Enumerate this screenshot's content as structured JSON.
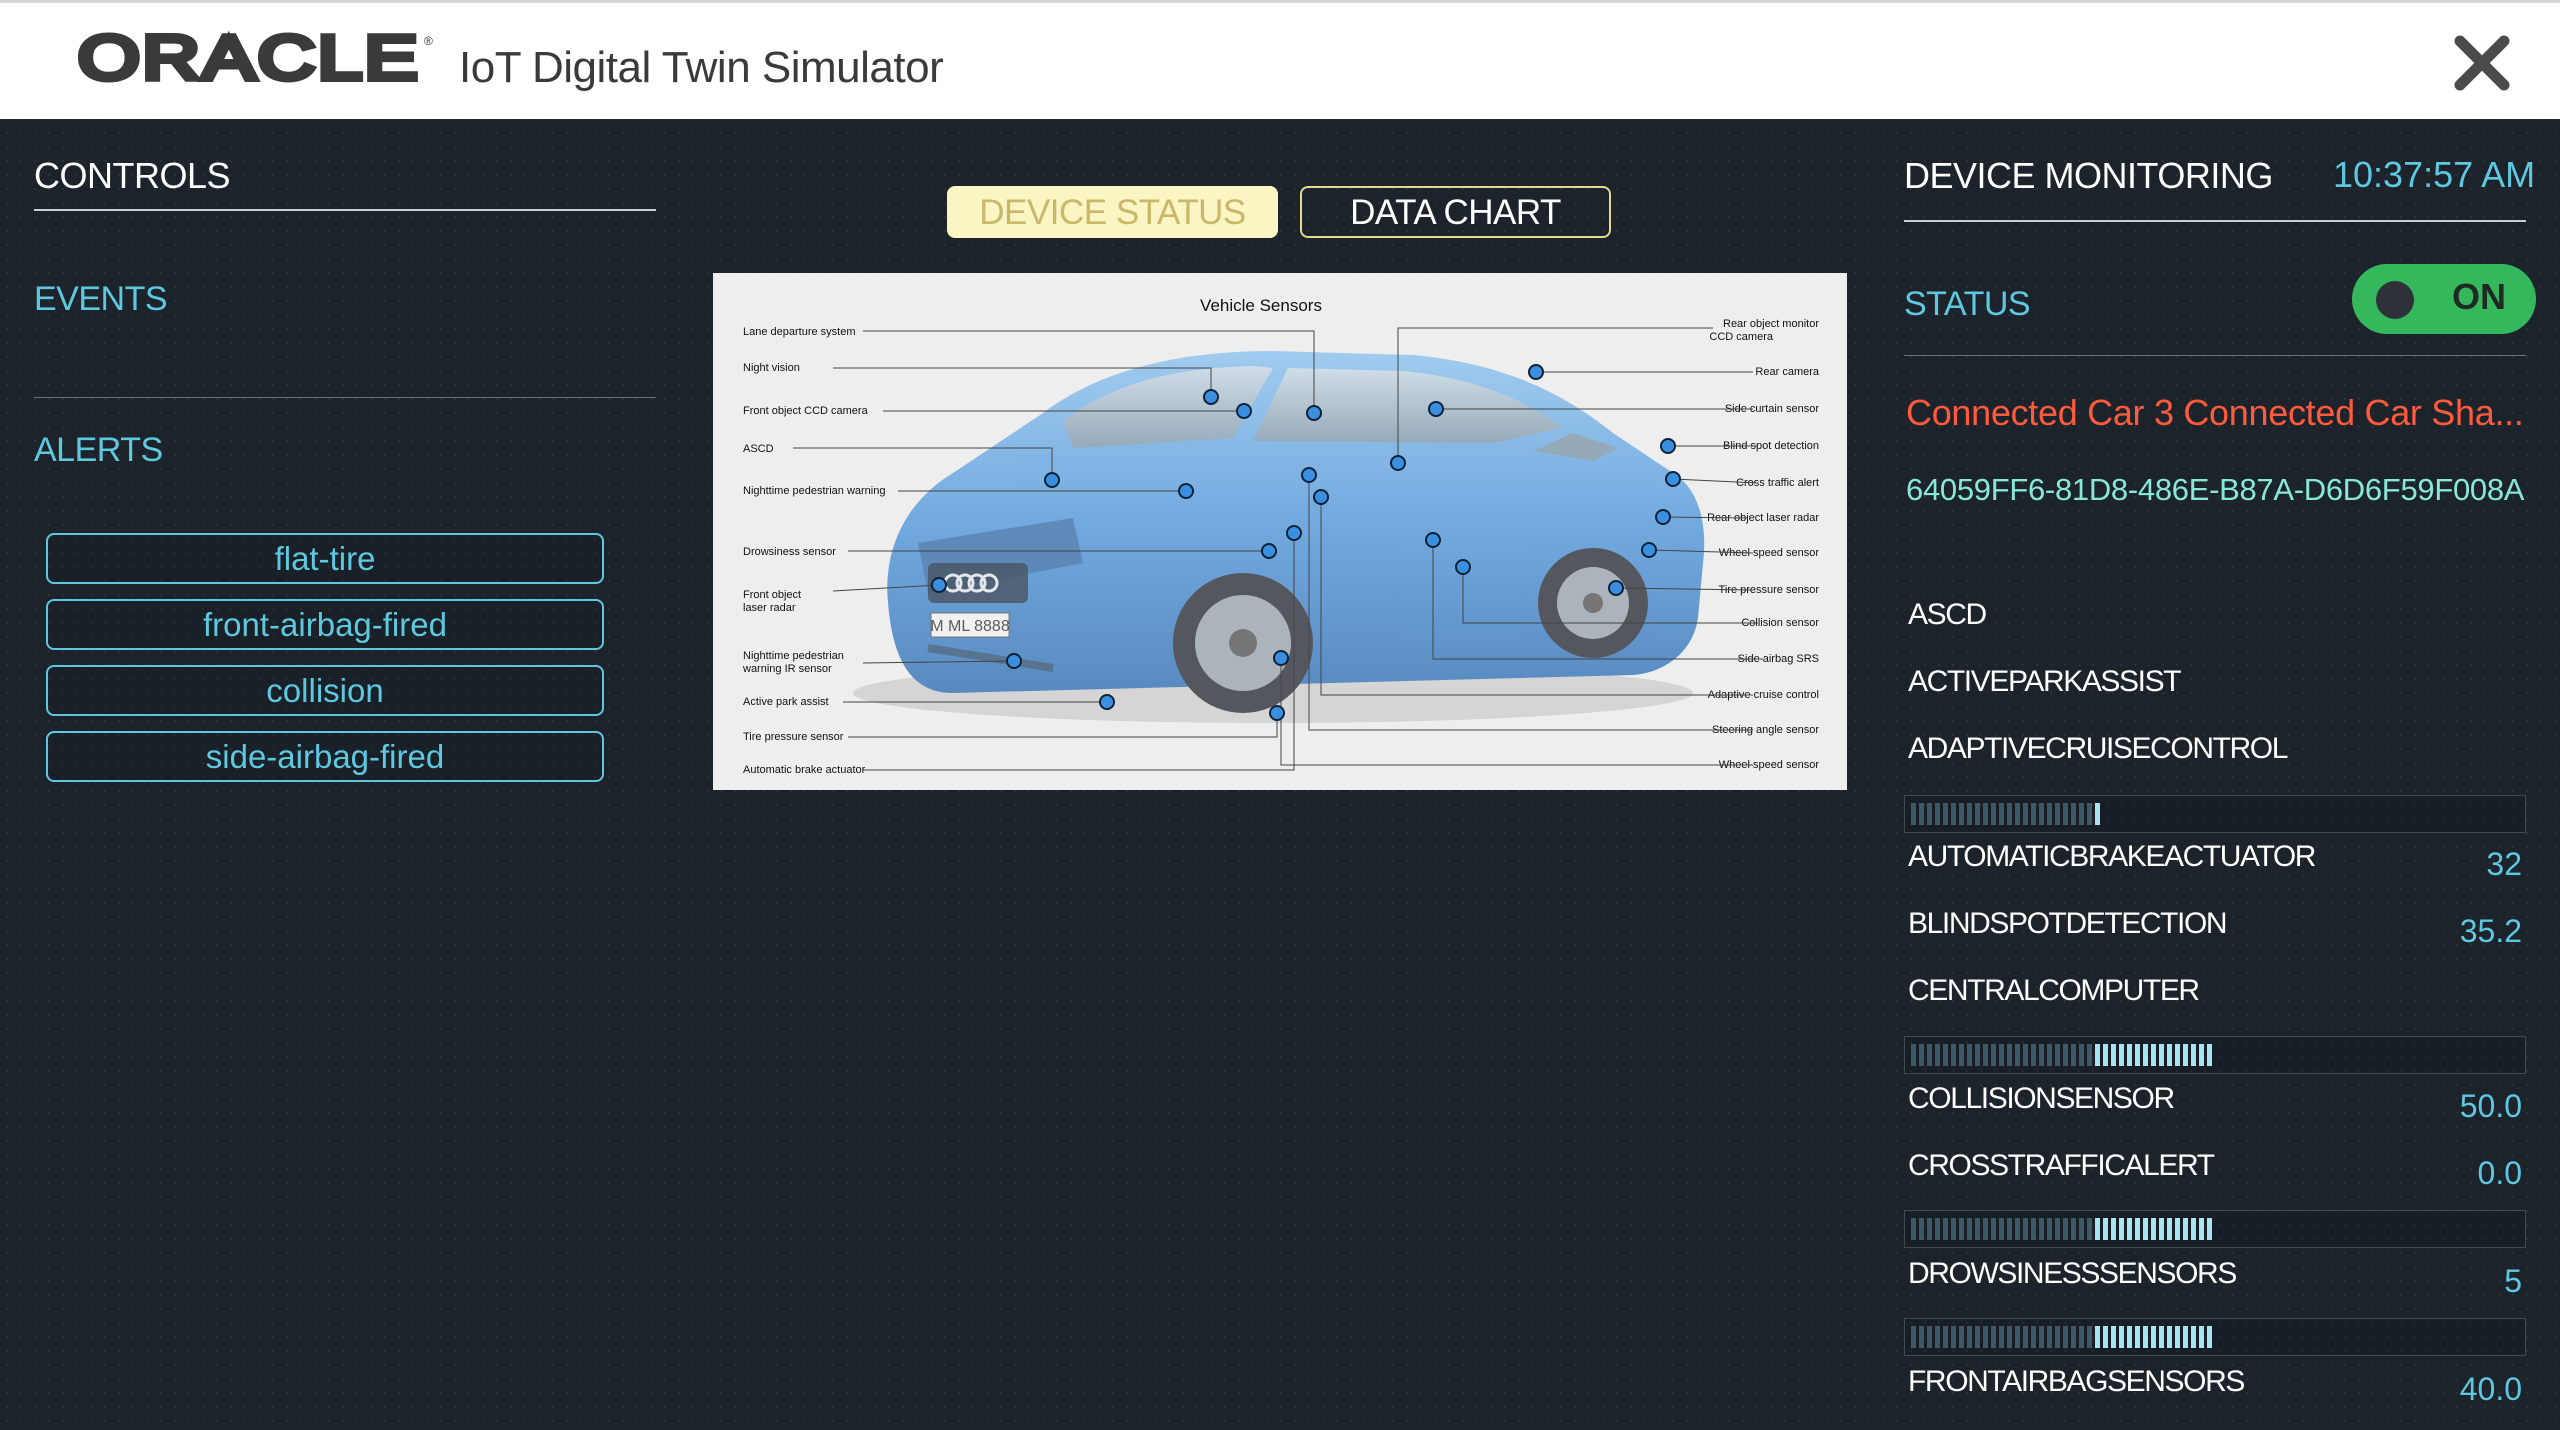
{
  "header": {
    "logo_text": "ORACLE",
    "title": "IoT Digital Twin Simulator",
    "close_icon": "close-icon"
  },
  "controls": {
    "title": "CONTROLS",
    "events_label": "EVENTS",
    "alerts_label": "ALERTS",
    "alerts": [
      "flat-tire",
      "front-airbag-fired",
      "collision",
      "side-airbag-fired"
    ]
  },
  "tabs": {
    "device_status": "DEVICE STATUS",
    "data_chart": "DATA CHART",
    "active": "DEVICE STATUS"
  },
  "vehicle_diagram": {
    "title": "Vehicle Sensors",
    "plate": "M ML 8888",
    "left_labels": [
      "Lane departure system",
      "Night vision",
      "Front object CCD camera",
      "ASCD",
      "Nighttime pedestrian warning",
      "Drowsiness sensor",
      "Front object",
      "laser radar",
      "Nighttime pedestrian",
      "warning IR sensor",
      "Active park assist",
      "Tire pressure sensor",
      "Automatic brake actuator"
    ],
    "right_labels": [
      "Rear object monitor",
      "CCD camera",
      "Rear camera",
      "Side curtain sensor",
      "Blind spot detection",
      "Cross traffic alert",
      "Rear object laser radar",
      "Wheel speed sensor",
      "Tire pressure sensor",
      "Collision sensor",
      "Side airbag SRS",
      "Adaptive cruise control",
      "Steering angle sensor",
      "Wheel speed sensor"
    ]
  },
  "monitoring": {
    "title": "DEVICE MONITORING",
    "time": "10:37:57 AM",
    "status_label": "STATUS",
    "toggle_label": "ON",
    "toggle_on": true,
    "device_name": "Connected Car 3 Connected Car Sha...",
    "device_id": "64059FF6-81D8-486E-B87A-D6D6F59F008A",
    "sensors": [
      {
        "name": "ASCD",
        "value": ""
      },
      {
        "name": "ACTIVEPARKASSIST",
        "value": ""
      },
      {
        "name": "ADAPTIVECRUISECONTROL",
        "value": ""
      },
      {
        "name": "AUTOMATICBRAKEACTUATOR",
        "value": "32"
      },
      {
        "name": "BLINDSPOTDETECTION",
        "value": "35.2"
      },
      {
        "name": "CENTRALCOMPUTER",
        "value": ""
      },
      {
        "name": "COLLISIONSENSOR",
        "value": "50.0"
      },
      {
        "name": "CROSSTRAFFICALERT",
        "value": "0.0"
      },
      {
        "name": "DROWSINESSSENSORS",
        "value": "5"
      },
      {
        "name": "FRONTAIRBAGSENSORS",
        "value": "40.0"
      }
    ],
    "gauges": [
      {
        "id": "automatic-brake-gauge",
        "level": 0.32,
        "highlight_from": 0.3
      },
      {
        "id": "collision-gauge",
        "level": 0.5,
        "highlight_from": 0.3
      },
      {
        "id": "drowsiness-gauge",
        "level": 0.5,
        "highlight_from": 0.3
      },
      {
        "id": "frontairbag-gauge",
        "level": 0.5,
        "highlight_from": 0.3
      }
    ]
  },
  "colors": {
    "background": "#1c232b",
    "accent_teal": "#5ec8e0",
    "device_name": "#ff5a3c",
    "device_id": "#88e8d6",
    "toggle_on": "#35b85b",
    "tab_active": "#fbf5c4",
    "car_body": "#4a90d9",
    "sensor_dot": "#3b8fe0"
  }
}
